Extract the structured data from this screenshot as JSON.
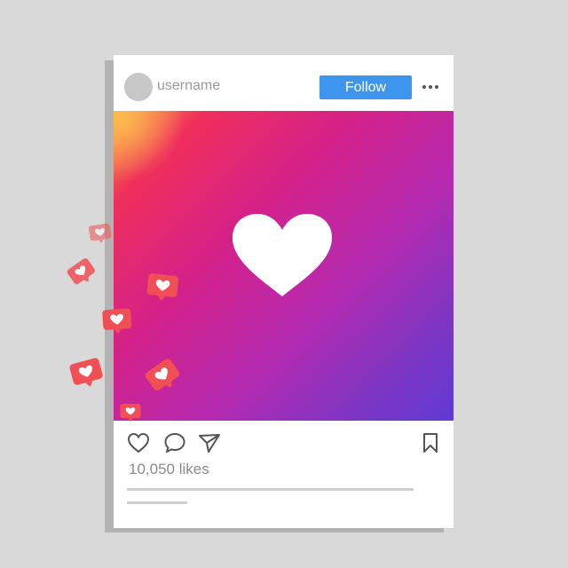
{
  "post": {
    "username": "username",
    "follow_label": "Follow",
    "likes_text": "10,050 likes"
  },
  "icons": {
    "more": "more-options-icon",
    "like": "heart-outline-icon",
    "comment": "comment-icon",
    "share": "send-icon",
    "save": "bookmark-icon",
    "main": "heart-icon",
    "notification": "like-notification-icon"
  },
  "colors": {
    "follow_button": "#3d95ee",
    "notification": "#f04f55",
    "gradient": [
      "#f9a640",
      "#ef2f5b",
      "#d4218a",
      "#b52bb0",
      "#8135c2",
      "#5f3ad3"
    ]
  }
}
